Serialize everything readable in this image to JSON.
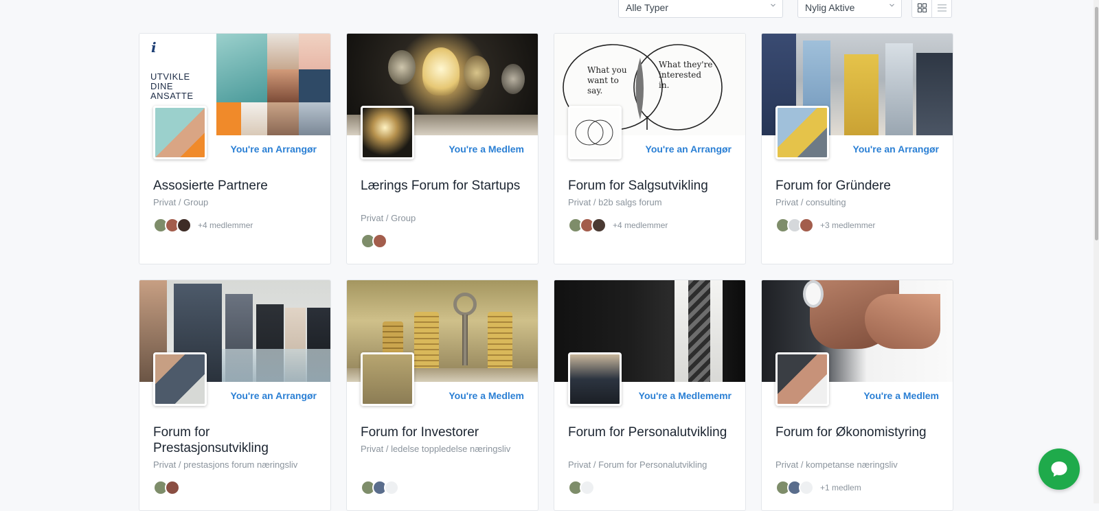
{
  "filters": {
    "type_select": "Alle Typer",
    "order_select": "Nylig Aktive",
    "grid_view_icon": "grid-icon",
    "list_view_icon": "list-icon"
  },
  "groups": [
    {
      "title": "Assosierte Partnere",
      "meta": "Privat / Group",
      "role": "You're an Arrangør",
      "members_text": "+4 medlemmer"
    },
    {
      "title": "Lærings Forum for Startups",
      "meta": "Privat / Group",
      "role": "You're a Medlem",
      "members_text": ""
    },
    {
      "title": "Forum for Salgsutvikling",
      "meta": "Privat / b2b salgs forum",
      "role": "You're an Arrangør",
      "members_text": "+4 medlemmer"
    },
    {
      "title": "Forum for Gründere",
      "meta": "Privat / consulting",
      "role": "You're an Arrangør",
      "members_text": "+3 medlemmer"
    },
    {
      "title": "Forum for Prestasjonsutvikling",
      "meta": "Privat / prestasjons forum næringsliv",
      "role": "You're an Arrangør",
      "members_text": ""
    },
    {
      "title": "Forum for Investorer",
      "meta": "Privat / ledelse toppledelse næringsliv",
      "role": "You're a Medlem",
      "members_text": ""
    },
    {
      "title": "Forum for Personalutvikling",
      "meta": "Privat / Forum for Personalutvikling",
      "role": "You're a Medlememr",
      "members_text": ""
    },
    {
      "title": "Forum for Økonomistyring",
      "meta": "Privat / kompetanse næringsliv",
      "role": "You're a Medlem",
      "members_text": "+1 medlem"
    }
  ],
  "cover_art": {
    "utvikle_logo_text": "i",
    "utvikle_headline": [
      "UTVIKLE",
      "DINE",
      "ANSATTE"
    ],
    "sketch_left": "What you want to say.",
    "sketch_right": "What they're interested in."
  },
  "chat": {
    "icon": "chat-bubble-icon"
  },
  "colors": {
    "accent": "#2a7fd4",
    "chat": "#1faa4b"
  }
}
